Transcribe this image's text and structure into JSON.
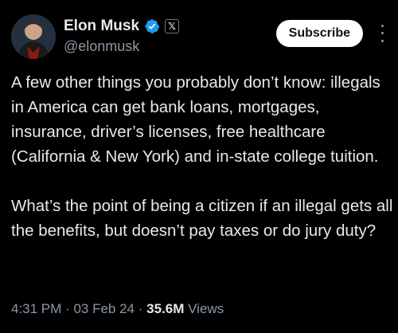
{
  "author": {
    "display_name": "Elon Musk",
    "handle": "@elonmusk",
    "verified_icon": "verified-badge-icon",
    "affiliation_icon": "x-logo-icon",
    "affiliation_glyph": "𝕏"
  },
  "actions": {
    "subscribe_label": "Subscribe",
    "more_icon": "more-options-icon"
  },
  "tweet": {
    "text": "A few other things you probably don’t know: illegals in America can get bank loans, mortgages, insurance, driver’s licenses, free healthcare (California & New York) and in-state college tuition.\n\nWhat’s the point of being a citizen if an illegal gets all the benefits, but doesn’t pay taxes or do jury duty?"
  },
  "meta": {
    "time": "4:31 PM",
    "separator": "·",
    "date": "03 Feb 24",
    "views_count": "35.6M",
    "views_label": "Views"
  },
  "colors": {
    "background": "#000000",
    "text": "#e7e9ea",
    "secondary_text": "#8b98a5",
    "verified": "#1d9bf0",
    "button_bg": "#ffffff"
  }
}
